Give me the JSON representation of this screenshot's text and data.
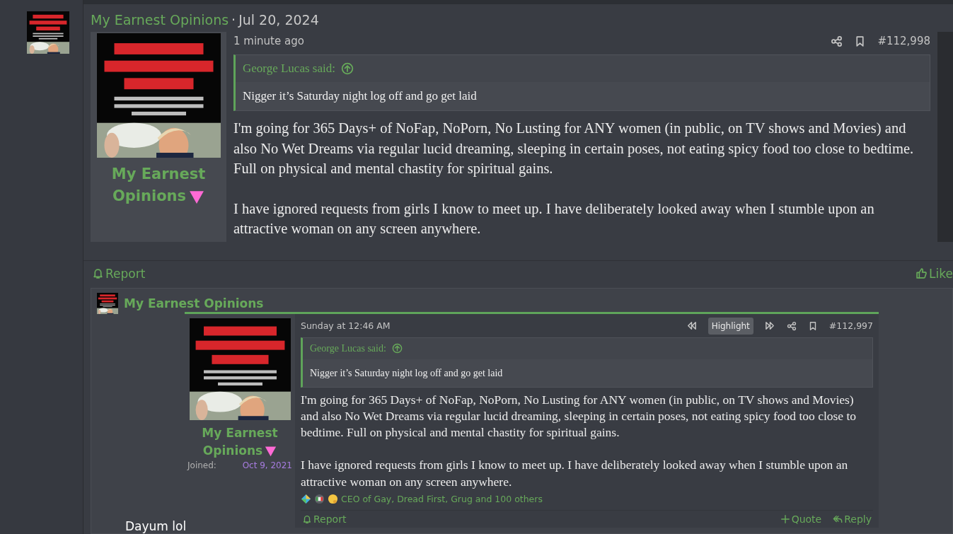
{
  "thread_header": {
    "author": "My Earnest Opinions",
    "separator": "·",
    "date": "Jul 20, 2024"
  },
  "post": {
    "author": "My Earnest Opinions",
    "time": "1 minute ago",
    "number": "#112,998",
    "quote": {
      "attribution": "George Lucas said:",
      "text": "Nigger it’s Saturday night log off and go get laid"
    },
    "paragraphs": [
      "I'm going for 365 Days+ of NoFap, NoPorn, No Lusting for ANY women (in public, on TV shows and Movies) and also No Wet Dreams via regular lucid dreaming, sleeping in certain poses, not eating spicy food too close to bedtime. Full on physical and mental chastity for spiritual gains.",
      "I have ignored requests from girls I know to meet up. I have deliberately looked away when I stumble upon an attractive woman on any screen anywhere."
    ],
    "actions": [
      {
        "kind": "report",
        "label": "Report"
      },
      {
        "kind": "like",
        "label": "Like"
      }
    ]
  },
  "embedded_post": {
    "author": "My Earnest Opinions",
    "user": {
      "name": "My Earnest Opinions",
      "joined_label": "Joined:",
      "joined_date": "Oct 9, 2021"
    },
    "time": "Sunday at 12:46 AM",
    "highlight": "Highlight",
    "number": "#112,997",
    "quote": {
      "attribution": "George Lucas said:",
      "text": "Nigger it’s Saturday night log off and go get laid"
    },
    "paragraphs": [
      "I'm going for 365 Days+ of NoFap, NoPorn, No Lusting for ANY women (in public, on TV shows and Movies) and also No Wet Dreams via regular lucid dreaming, sleeping in certain poses, not eating spicy food too close to bedtime. Full on physical and mental chastity for spiritual gains.",
      "I have ignored requests from girls I know to meet up. I have deliberately looked away when I stumble upon an attractive woman on any screen anywhere."
    ],
    "reactions": "CEO of Gay, Dread First, Grug and 100 others",
    "actions": [
      {
        "kind": "report",
        "label": "Report"
      },
      {
        "kind": "quote",
        "label": "Quote"
      },
      {
        "kind": "reply",
        "label": "Reply"
      }
    ]
  },
  "comment": "Dayum lol"
}
